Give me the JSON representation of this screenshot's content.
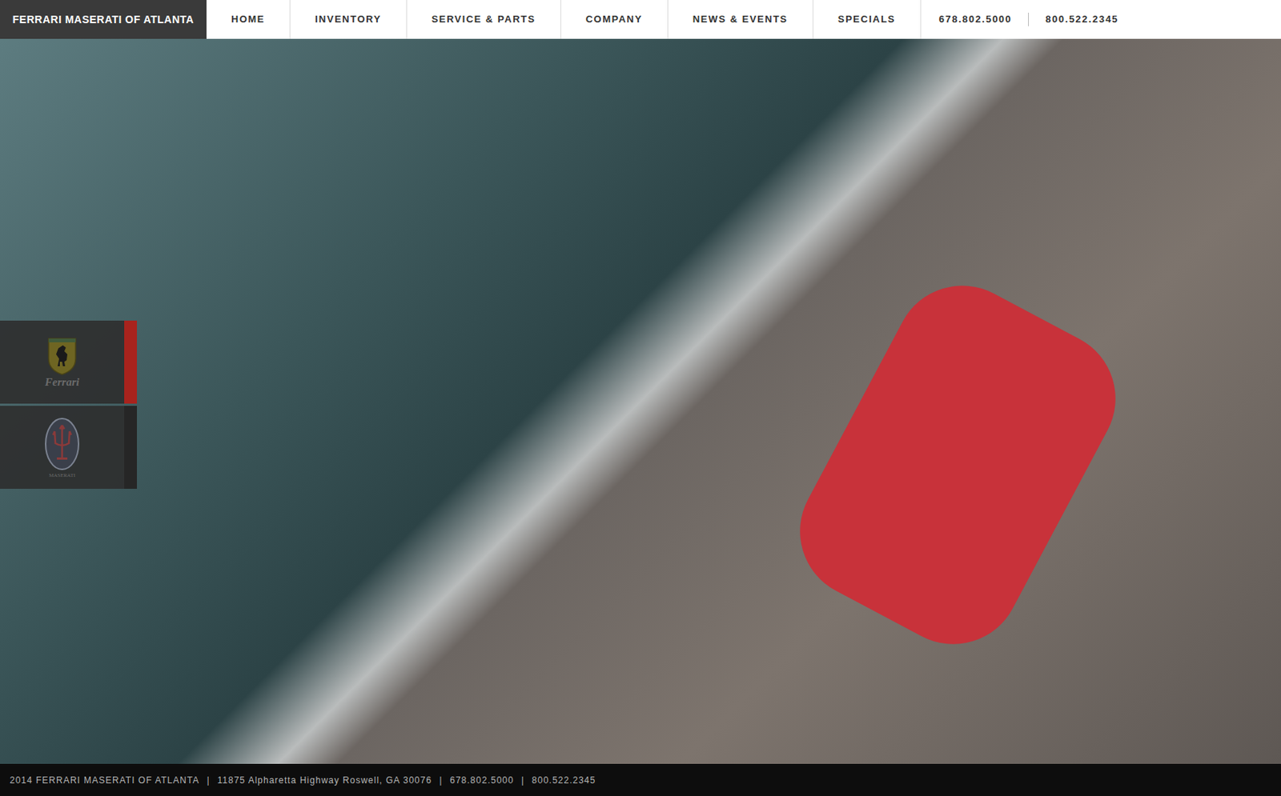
{
  "header": {
    "brand": "FERRARI MASERATI OF ATLANTA",
    "nav": [
      {
        "label": "HOME",
        "selected": false
      },
      {
        "label": "INVENTORY",
        "selected": false
      },
      {
        "label": "SERVICE & PARTS",
        "selected": false
      },
      {
        "label": "COMPANY",
        "selected": false
      },
      {
        "label": "NEWS & EVENTS",
        "selected": false
      },
      {
        "label": "SPECIALS",
        "selected": false
      }
    ],
    "phones": [
      "678.802.5000",
      "800.522.2345"
    ]
  },
  "brands": [
    {
      "name": "Ferrari",
      "selected": true
    },
    {
      "name": "MASERATI",
      "selected": false
    }
  ],
  "footer": {
    "items": [
      "2014 FERRARI MASERATI OF ATLANTA",
      "11875 Alpharetta Highway Roswell, GA 30076",
      "678.802.5000",
      "800.522.2345"
    ],
    "separator": "|"
  }
}
